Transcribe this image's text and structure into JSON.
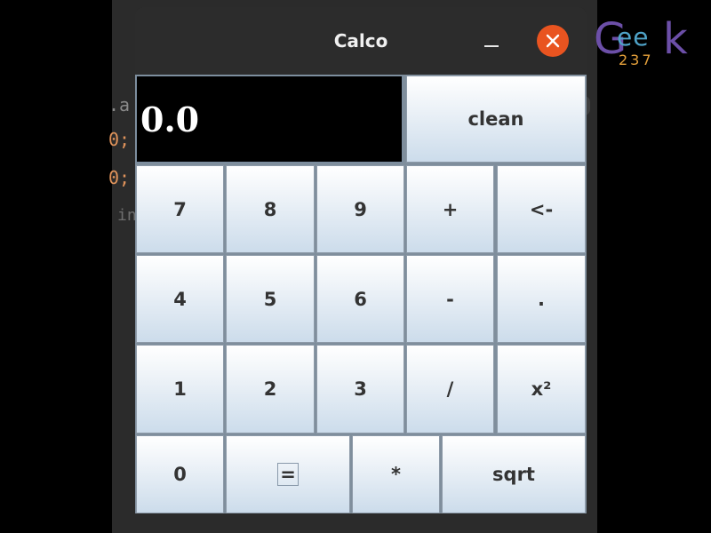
{
  "background": {
    "code_fragments": [
      ".a",
      "0;",
      "0;",
      "in"
    ]
  },
  "logo": {
    "letter_g": "G",
    "letters_ee": "ee",
    "number": "237",
    "letter_k": "k"
  },
  "window": {
    "title": "Calco",
    "minimize_icon": "minimize-icon",
    "close_icon": "close-icon",
    "close_color": "#e95420"
  },
  "display": {
    "value": "0.0"
  },
  "buttons": {
    "clean": "clean",
    "seven": "7",
    "eight": "8",
    "nine": "9",
    "plus": "+",
    "backspace": "<-",
    "four": "4",
    "five": "5",
    "six": "6",
    "minus": "-",
    "dot": ".",
    "one": "1",
    "two": "2",
    "three": "3",
    "divide": "/",
    "square": "x²",
    "zero": "0",
    "equals": "=",
    "multiply": "*",
    "sqrt": "sqrt"
  }
}
